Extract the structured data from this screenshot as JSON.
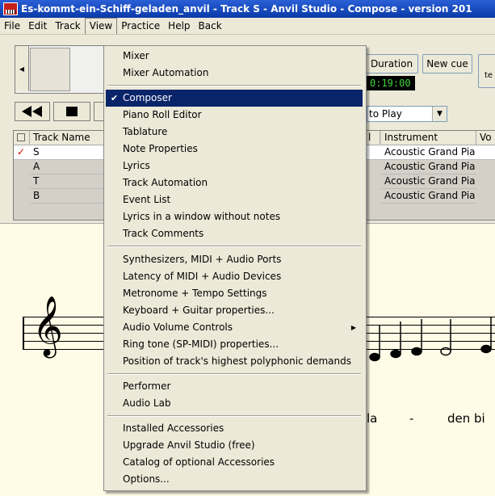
{
  "window": {
    "title": "Es-kommt-ein-Schiff-geladen_anvil - Track S - Anvil Studio - Compose - version 201"
  },
  "menubar": {
    "items": [
      "File",
      "Edit",
      "Track",
      "View",
      "Practice",
      "Help",
      "Back"
    ]
  },
  "toolbar": {
    "duration_label": "Duration",
    "new_cue_label": "New cue",
    "time_display": "0:19:00",
    "auto_play_value": "to Play",
    "te_label": "te"
  },
  "tracks": {
    "headers": {
      "name": "Track Name",
      "instrument": "Instrument",
      "vol": "Vo"
    },
    "rows": [
      {
        "name": "S",
        "instrument": "Acoustic Grand Pia",
        "checked": true
      },
      {
        "name": "A",
        "instrument": "Acoustic Grand Pia",
        "checked": false
      },
      {
        "name": "T",
        "instrument": "Acoustic Grand Pia",
        "checked": false
      },
      {
        "name": "B",
        "instrument": "Acoustic Grand Pia",
        "checked": false
      }
    ]
  },
  "score": {
    "lyrics": [
      "la",
      "-",
      "den bi"
    ]
  },
  "view_menu": {
    "group1": [
      "Mixer",
      "Mixer Automation"
    ],
    "group2": [
      "Composer",
      "Piano Roll Editor",
      "Tablature",
      "Note Properties",
      "Lyrics",
      "Track Automation",
      "Event List",
      "Lyrics in a window without notes",
      "Track Comments"
    ],
    "group3": [
      "Synthesizers, MIDI + Audio Ports",
      "Latency of MIDI + Audio Devices",
      "Metronome + Tempo Settings",
      "Keyboard + Guitar properties...",
      "Audio Volume Controls",
      "Ring tone (SP-MIDI) properties...",
      "Position of track's highest polyphonic demands"
    ],
    "group4": [
      "Performer",
      "Audio Lab"
    ],
    "group5": [
      "Installed Accessories",
      "Upgrade Anvil Studio (free)",
      "Catalog of optional Accessories",
      "Options..."
    ],
    "selected": "Composer"
  },
  "colors": {
    "highlight": "#0a246a",
    "title_bar": "#0a3aa8",
    "score_bg": "#fffbe6",
    "time_text": "#3fd83f"
  }
}
